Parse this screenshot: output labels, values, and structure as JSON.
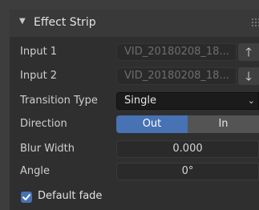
{
  "panel": {
    "title": "Effect Strip",
    "input1": {
      "label": "Input 1",
      "value": "VID_20180208_18..."
    },
    "input2": {
      "label": "Input 2",
      "value": "VID_20180208_18..."
    },
    "transition_type": {
      "label": "Transition Type",
      "value": "Single"
    },
    "direction": {
      "label": "Direction",
      "options": [
        "Out",
        "In"
      ],
      "selected": "Out"
    },
    "blur_width": {
      "label": "Blur Width",
      "value": "0.000"
    },
    "angle": {
      "label": "Angle",
      "value": "0°"
    },
    "default_fade": {
      "label": "Default fade",
      "checked": true
    }
  },
  "colors": {
    "accent": "#4772b3",
    "panel_bg": "#2f2f2f",
    "header_bg": "#393939"
  },
  "icons": {
    "collapse": "disclosure-triangle-down",
    "swap_up": "arrow-up",
    "swap_down": "arrow-down",
    "dropdown": "chevron-down",
    "grip": "drag-grip",
    "check": "checkmark"
  }
}
